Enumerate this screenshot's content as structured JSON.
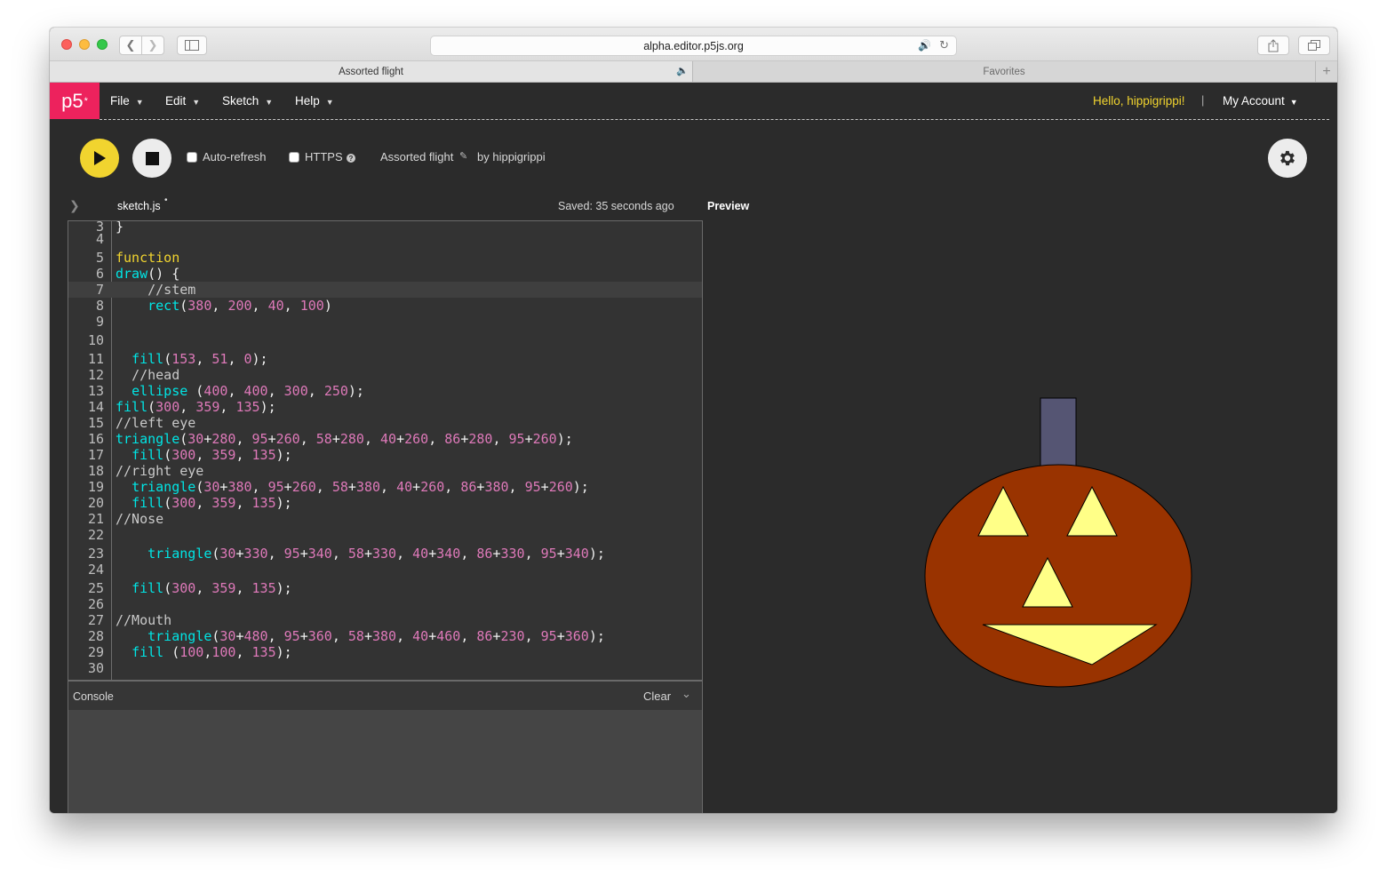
{
  "browser": {
    "url": "alpha.editor.p5js.org",
    "tabs": [
      {
        "label": "Assorted flight",
        "active": true
      },
      {
        "label": "Favorites",
        "active": false
      }
    ]
  },
  "app": {
    "logo": "p5",
    "logo_mark": "*",
    "menu": [
      "File",
      "Edit",
      "Sketch",
      "Help"
    ],
    "greeting": "Hello, hippigrippi!",
    "separator": "|",
    "account": "My Account",
    "accent_color": "#ed225d",
    "play_color": "#f1d42f"
  },
  "toolbar": {
    "autorefresh_label": "Auto-refresh",
    "autorefresh_checked": false,
    "https_label": "HTTPS",
    "https_checked": false,
    "project_name": "Assorted flight",
    "project_owner": "by hippigrippi"
  },
  "editor": {
    "file_name": "sketch.js",
    "unsaved_marker": "•",
    "saved_status": "Saved: 35 seconds ago",
    "preview_label": "Preview",
    "lines": [
      {
        "n": "3",
        "code": "}"
      },
      {
        "n": "4",
        "code": ""
      },
      {
        "n": "5",
        "code": "function"
      },
      {
        "n": "6",
        "code": "draw() {"
      },
      {
        "n": "7",
        "code": "    //stem",
        "active": true
      },
      {
        "n": "8",
        "code": "    rect(380, 200, 40, 100)"
      },
      {
        "n": "9",
        "code": ""
      },
      {
        "n": "10",
        "code": ""
      },
      {
        "n": "11",
        "code": "  fill(153, 51, 0);"
      },
      {
        "n": "12",
        "code": "  //head"
      },
      {
        "n": "13",
        "code": "  ellipse (400, 400, 300, 250);"
      },
      {
        "n": "14",
        "code": "fill(300, 359, 135);"
      },
      {
        "n": "15",
        "code": "//left eye"
      },
      {
        "n": "16",
        "code": "triangle(30+280, 95+260, 58+280, 40+260, 86+280, 95+260);"
      },
      {
        "n": "17",
        "code": "  fill(300, 359, 135);"
      },
      {
        "n": "18",
        "code": "//right eye"
      },
      {
        "n": "19",
        "code": "  triangle(30+380, 95+260, 58+380, 40+260, 86+380, 95+260);"
      },
      {
        "n": "20",
        "code": "  fill(300, 359, 135);"
      },
      {
        "n": "21",
        "code": "//Nose"
      },
      {
        "n": "22",
        "code": ""
      },
      {
        "n": "23",
        "code": "    triangle(30+330, 95+340, 58+330, 40+340, 86+330, 95+340);"
      },
      {
        "n": "24",
        "code": ""
      },
      {
        "n": "25",
        "code": "  fill(300, 359, 135);"
      },
      {
        "n": "26",
        "code": ""
      },
      {
        "n": "27",
        "code": "//Mouth"
      },
      {
        "n": "28",
        "code": "    triangle(30+480, 95+360, 58+380, 40+460, 86+230, 95+360);"
      },
      {
        "n": "29",
        "code": "  fill (100,100, 135);"
      },
      {
        "n": "30",
        "code": ""
      }
    ],
    "colors": {
      "keyword": "#f1d42f",
      "function": "#00e5e5",
      "number": "#de79b9",
      "comment": "#c9c9c9",
      "text": "#f0f0f0"
    }
  },
  "console": {
    "label": "Console",
    "clear_label": "Clear"
  },
  "preview": {
    "colors": {
      "stem": "#555573",
      "head": "#993300",
      "features": "#ffff87"
    }
  }
}
